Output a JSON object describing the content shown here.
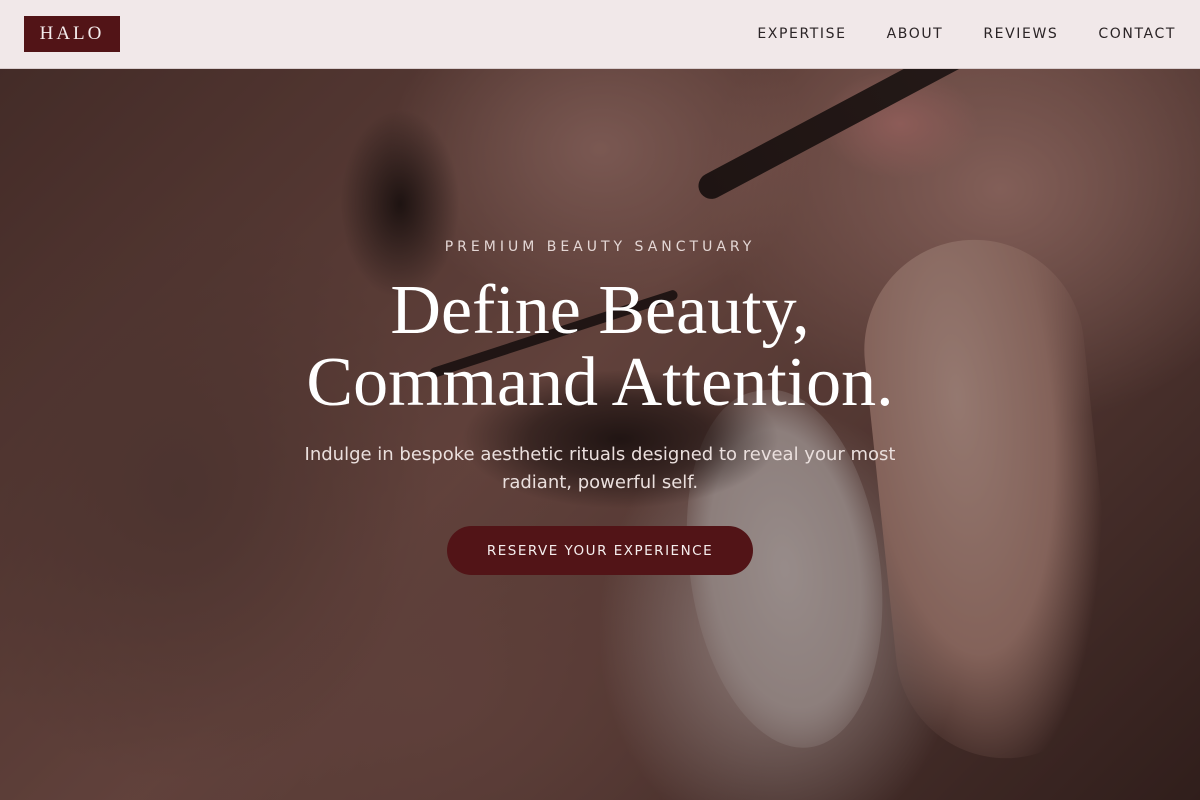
{
  "brand": {
    "logo_text": "HALO",
    "accent_color": "#521417"
  },
  "nav": {
    "items": [
      {
        "label": "EXPERTISE"
      },
      {
        "label": "ABOUT"
      },
      {
        "label": "REVIEWS"
      },
      {
        "label": "CONTACT"
      }
    ]
  },
  "hero": {
    "eyebrow": "PREMIUM BEAUTY SANCTUARY",
    "headline_line1": "Define Beauty,",
    "headline_line2": "Command Attention.",
    "subtext": "Indulge in bespoke aesthetic rituals designed to reveal your most radiant, powerful self.",
    "cta_label": "RESERVE YOUR EXPERIENCE"
  }
}
